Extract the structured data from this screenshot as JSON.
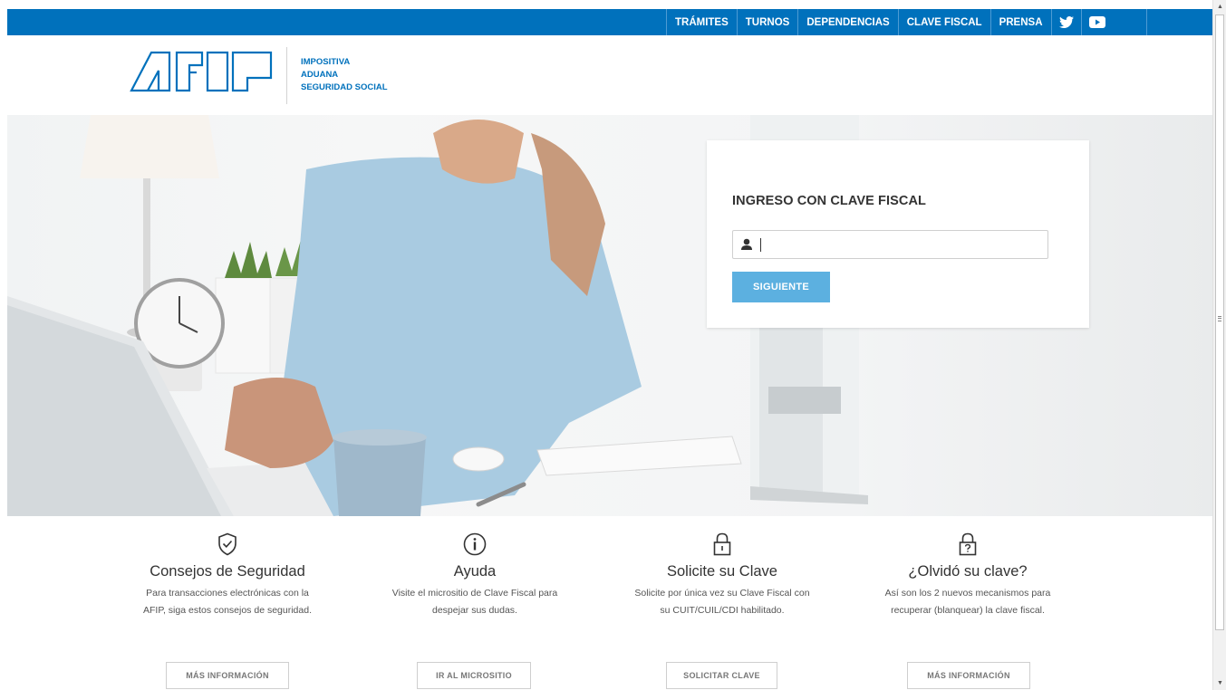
{
  "topnav": {
    "items": [
      "TRÁMITES",
      "TURNOS",
      "DEPENDENCIAS",
      "CLAVE FISCAL",
      "PRENSA"
    ],
    "social": [
      "twitter-icon",
      "youtube-icon"
    ]
  },
  "header": {
    "logo_lines": [
      "IMPOSITIVA",
      "ADUANA",
      "SEGURIDAD SOCIAL"
    ]
  },
  "login": {
    "title": "INGRESO CON CLAVE FISCAL",
    "input_value": "",
    "button_label": "SIGUIENTE"
  },
  "features": [
    {
      "icon": "shield-check-icon",
      "title": "Consejos de Seguridad",
      "desc_line1": "Para transacciones electrónicas con la",
      "desc_line2": "AFIP, siga estos consejos de seguridad.",
      "button": "MÁS INFORMACIÓN"
    },
    {
      "icon": "info-icon",
      "title": "Ayuda",
      "desc_line1": "Visite el micrositio de Clave Fiscal para",
      "desc_line2": "despejar sus dudas.",
      "button": "IR AL MICROSITIO"
    },
    {
      "icon": "lock-icon",
      "title": "Solicite su Clave",
      "desc_line1": "Solicite por única vez su Clave Fiscal con",
      "desc_line2": "su CUIT/CUIL/CDI habilitado.",
      "button": "SOLICITAR CLAVE"
    },
    {
      "icon": "lock-question-icon",
      "title": "¿Olvidó su clave?",
      "desc_line1": "Así son los 2 nuevos mecanismos para",
      "desc_line2": "recuperar (blanquear) la clave fiscal.",
      "button": "MÁS INFORMACIÓN"
    }
  ],
  "colors": {
    "brand_blue": "#0071bc",
    "button_blue": "#5cb0e0"
  }
}
